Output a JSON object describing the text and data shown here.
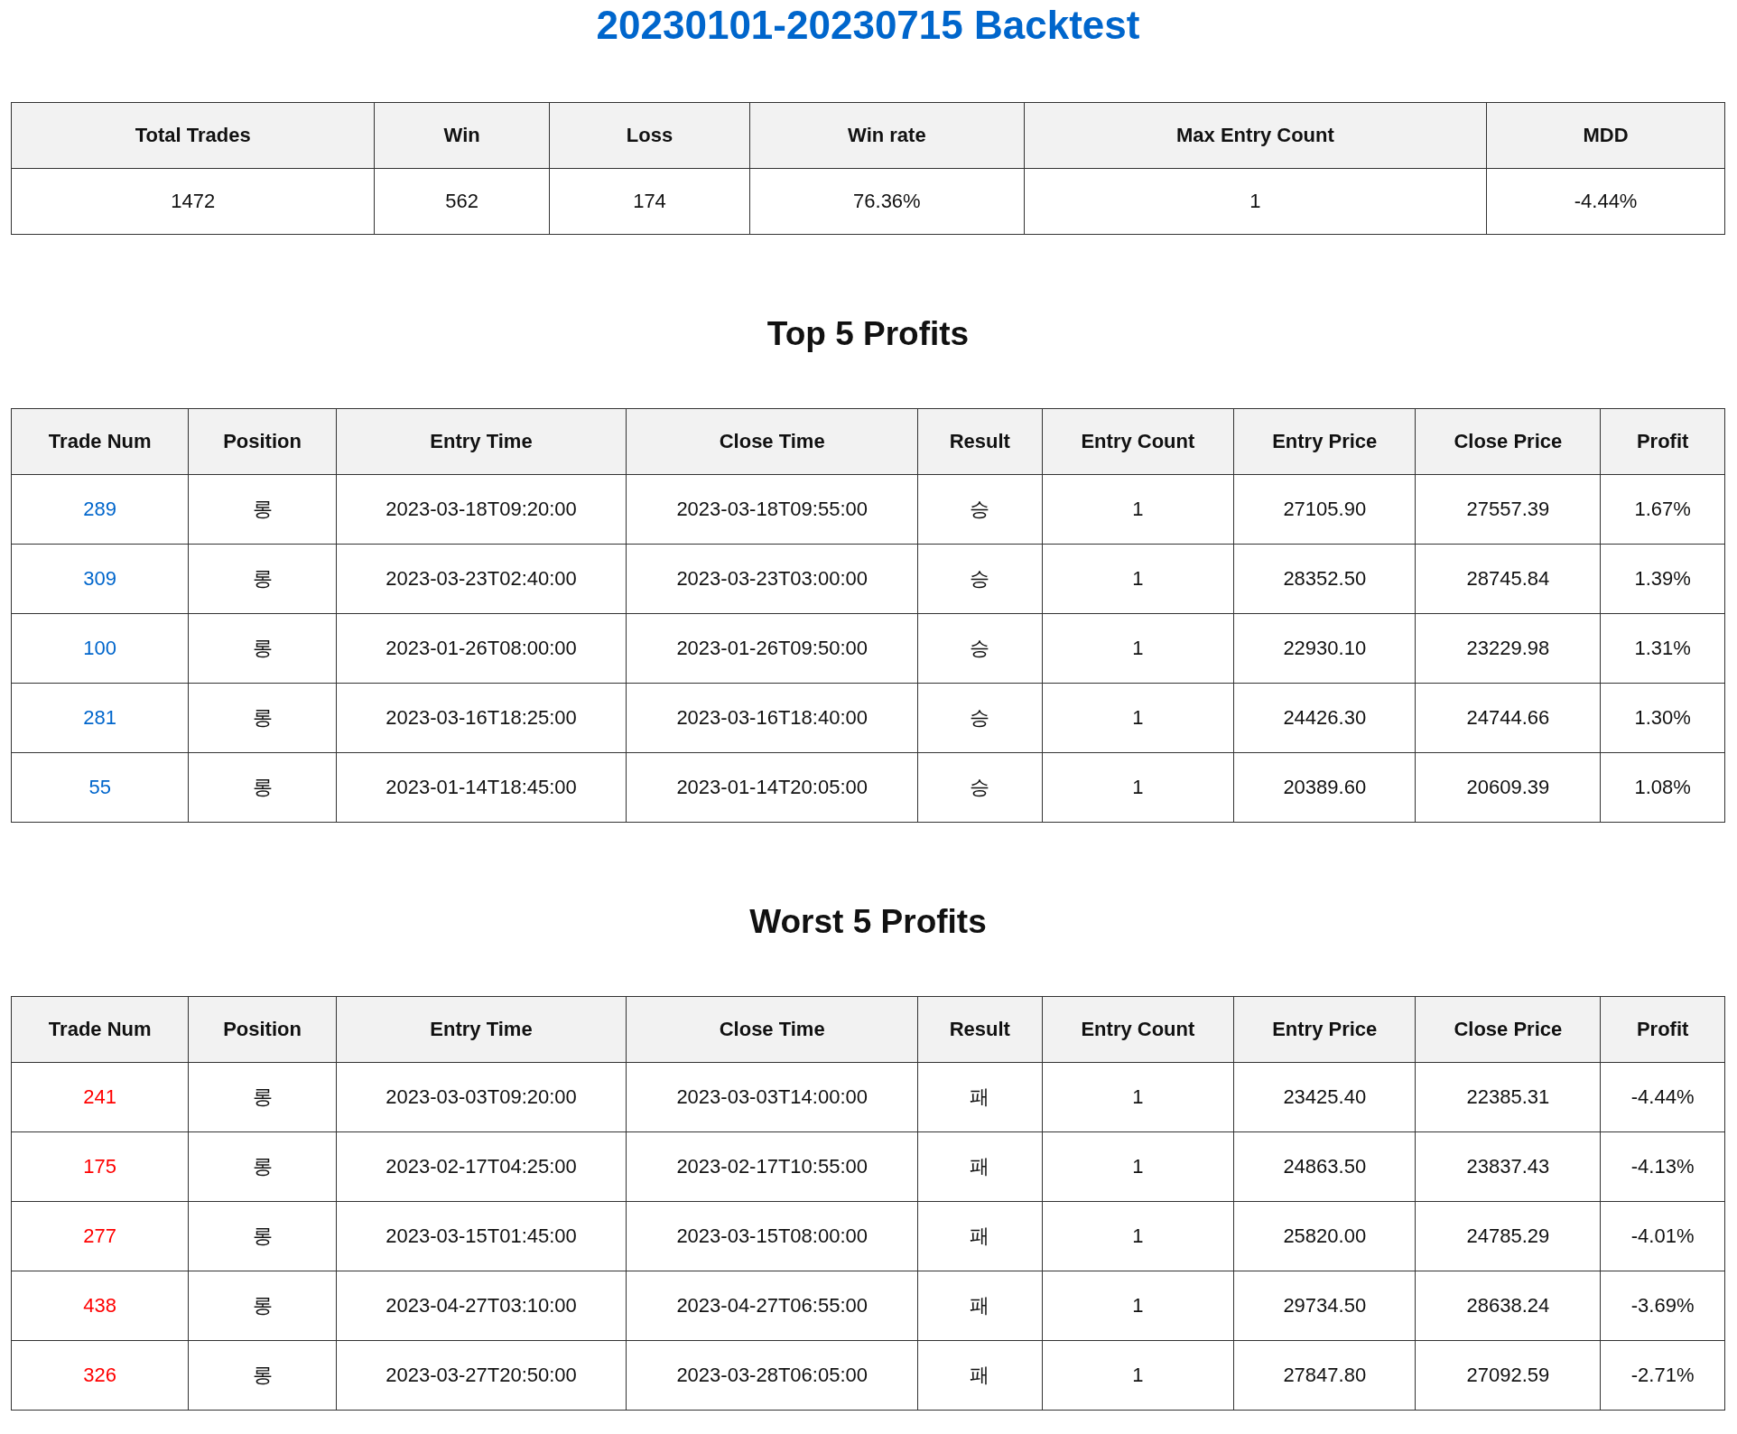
{
  "title": "20230101-20230715 Backtest",
  "summary": {
    "columns": [
      "Total Trades",
      "Win",
      "Loss",
      "Win rate",
      "Max Entry Count",
      "MDD"
    ],
    "values": [
      "1472",
      "562",
      "174",
      "76.36%",
      "1",
      "-4.44%"
    ]
  },
  "sections": [
    {
      "heading": "Top 5 Profits",
      "kind": "top",
      "columns": [
        "Trade Num",
        "Position",
        "Entry Time",
        "Close Time",
        "Result",
        "Entry Count",
        "Entry Price",
        "Close Price",
        "Profit"
      ],
      "rows": [
        [
          "289",
          "롱",
          "2023-03-18T09:20:00",
          "2023-03-18T09:55:00",
          "승",
          "1",
          "27105.90",
          "27557.39",
          "1.67%"
        ],
        [
          "309",
          "롱",
          "2023-03-23T02:40:00",
          "2023-03-23T03:00:00",
          "승",
          "1",
          "28352.50",
          "28745.84",
          "1.39%"
        ],
        [
          "100",
          "롱",
          "2023-01-26T08:00:00",
          "2023-01-26T09:50:00",
          "승",
          "1",
          "22930.10",
          "23229.98",
          "1.31%"
        ],
        [
          "281",
          "롱",
          "2023-03-16T18:25:00",
          "2023-03-16T18:40:00",
          "승",
          "1",
          "24426.30",
          "24744.66",
          "1.30%"
        ],
        [
          "55",
          "롱",
          "2023-01-14T18:45:00",
          "2023-01-14T20:05:00",
          "승",
          "1",
          "20389.60",
          "20609.39",
          "1.08%"
        ]
      ]
    },
    {
      "heading": "Worst 5 Profits",
      "kind": "worst",
      "columns": [
        "Trade Num",
        "Position",
        "Entry Time",
        "Close Time",
        "Result",
        "Entry Count",
        "Entry Price",
        "Close Price",
        "Profit"
      ],
      "rows": [
        [
          "241",
          "롱",
          "2023-03-03T09:20:00",
          "2023-03-03T14:00:00",
          "패",
          "1",
          "23425.40",
          "22385.31",
          "-4.44%"
        ],
        [
          "175",
          "롱",
          "2023-02-17T04:25:00",
          "2023-02-17T10:55:00",
          "패",
          "1",
          "24863.50",
          "23837.43",
          "-4.13%"
        ],
        [
          "277",
          "롱",
          "2023-03-15T01:45:00",
          "2023-03-15T08:00:00",
          "패",
          "1",
          "25820.00",
          "24785.29",
          "-4.01%"
        ],
        [
          "438",
          "롱",
          "2023-04-27T03:10:00",
          "2023-04-27T06:55:00",
          "패",
          "1",
          "29734.50",
          "28638.24",
          "-3.69%"
        ],
        [
          "326",
          "롱",
          "2023-03-27T20:50:00",
          "2023-03-28T06:05:00",
          "패",
          "1",
          "27847.80",
          "27092.59",
          "-2.71%"
        ]
      ]
    }
  ]
}
